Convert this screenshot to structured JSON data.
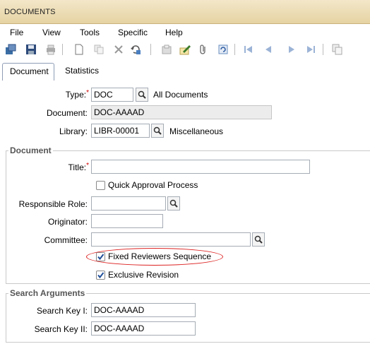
{
  "window": {
    "title": "DOCUMENTS"
  },
  "menu": {
    "file": "File",
    "view": "View",
    "tools": "Tools",
    "specific": "Specific",
    "help": "Help"
  },
  "toolbar": {
    "icons": [
      "new-record-icon",
      "save-icon",
      "print-icon",
      "blank-page-icon",
      "copy-icon",
      "delete-icon",
      "undo-icon",
      "print-preview-icon",
      "edit-icon",
      "attach-icon",
      "refresh-icon",
      "first-record-icon",
      "previous-record-icon",
      "next-record-icon",
      "last-record-icon",
      "duplicate-icon"
    ]
  },
  "tabs": {
    "document": "Document",
    "statistics": "Statistics"
  },
  "header": {
    "type_label": "Type:",
    "type_value": "DOC",
    "type_desc": "All Documents",
    "document_label": "Document:",
    "document_value": "DOC-AAAAD",
    "library_label": "Library:",
    "library_value": "LIBR-00001",
    "library_desc": "Miscellaneous"
  },
  "document_section": {
    "legend": "Document",
    "title_label": "Title:",
    "title_value": "",
    "quick_approval_label": "Quick Approval Process",
    "quick_approval_checked": false,
    "responsible_role_label": "Responsible Role:",
    "responsible_role_value": "",
    "originator_label": "Originator:",
    "originator_value": "",
    "committee_label": "Committee:",
    "committee_value": "",
    "fixed_reviewers_label": "Fixed Reviewers Sequence",
    "fixed_reviewers_checked": true,
    "exclusive_revision_label": "Exclusive Revision",
    "exclusive_revision_checked": true
  },
  "search_section": {
    "legend": "Search Arguments",
    "key1_label": "Search Key I:",
    "key1_value": "DOC-AAAAD",
    "key2_label": "Search Key II:",
    "key2_value": "DOC-AAAAD"
  },
  "colors": {
    "titlebar": "#e6d3a3",
    "required": "#d00000",
    "highlight_oval": "#dd2222",
    "checkbox_tick": "#1f4e99"
  }
}
